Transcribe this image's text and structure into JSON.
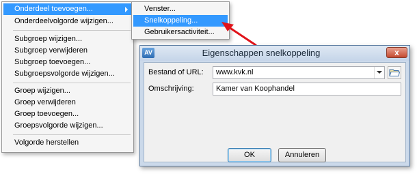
{
  "context_menu": {
    "items": [
      {
        "label": "Onderdeel toevoegen...",
        "has_submenu": true,
        "active": true
      },
      {
        "label": "Onderdeelvolgorde wijzigen..."
      },
      {
        "label": "Subgroep wijzigen..."
      },
      {
        "label": "Subgroep verwijderen"
      },
      {
        "label": "Subgroep toevoegen..."
      },
      {
        "label": "Subgroepsvolgorde wijzigen..."
      },
      {
        "label": "Groep wijzigen..."
      },
      {
        "label": "Groep verwijderen"
      },
      {
        "label": "Groep toevoegen..."
      },
      {
        "label": "Groepsvolgorde wijzigen..."
      },
      {
        "label": "Volgorde herstellen"
      }
    ]
  },
  "submenu": {
    "items": [
      {
        "label": "Venster..."
      },
      {
        "label": "Snelkoppeling...",
        "active": true
      },
      {
        "label": "Gebruikersactiviteit..."
      }
    ]
  },
  "dialog": {
    "app_icon": "AV",
    "title": "Eigenschappen snelkoppeling",
    "close_glyph": "x",
    "fields": {
      "url_label": "Bestand of URL:",
      "url_value": "www.kvk.nl",
      "description_label": "Omschrijving:",
      "description_value": "Kamer van Koophandel"
    },
    "buttons": {
      "ok": "OK",
      "cancel": "Annuleren"
    }
  },
  "colors": {
    "highlight": "#3399ff",
    "arrow": "#e0131a"
  }
}
